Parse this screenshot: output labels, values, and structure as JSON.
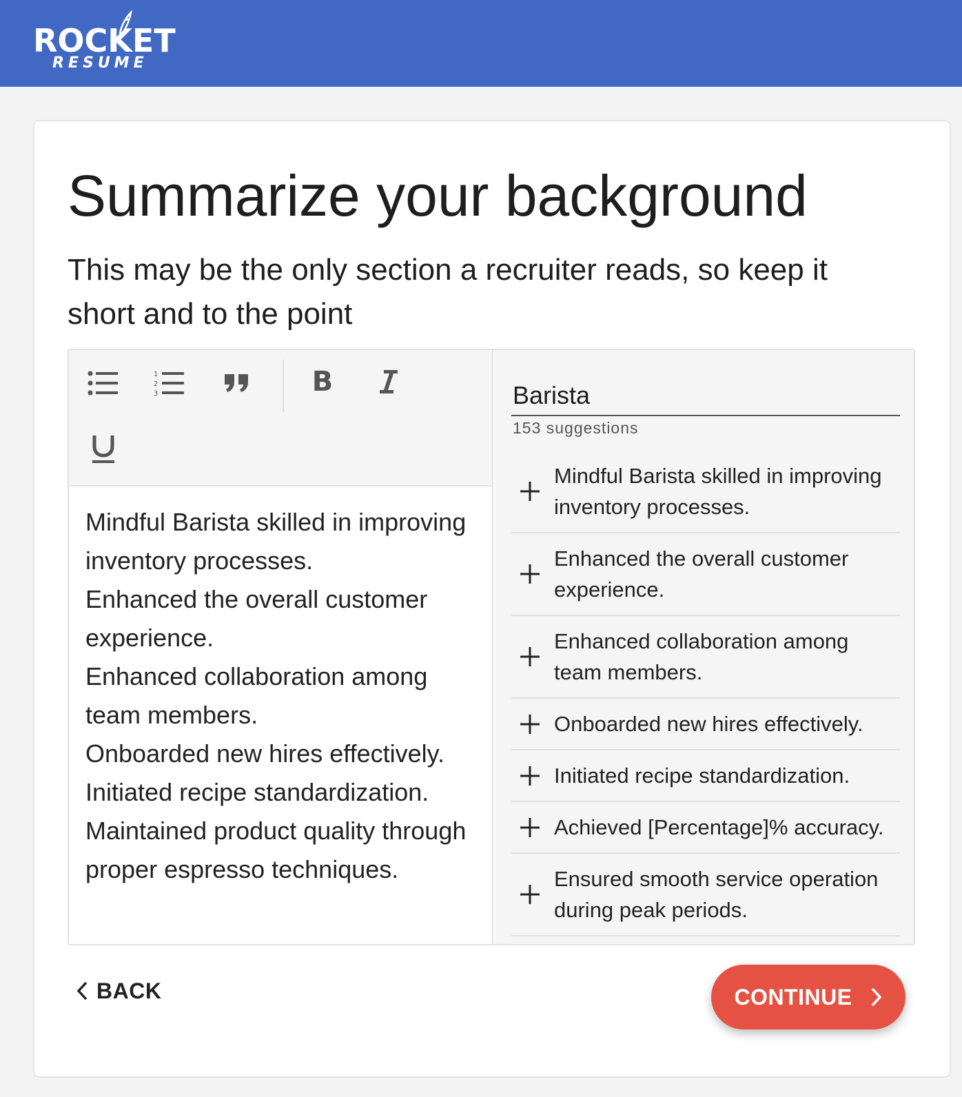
{
  "header": {
    "logo_line1": "ROCKET",
    "logo_line2": "RESUME",
    "color": "#4169c3"
  },
  "page": {
    "title": "Summarize your background",
    "subtitle": "This may be the only section a recruiter reads, so keep it short and to the point"
  },
  "toolbar": {
    "buttons": [
      {
        "name": "bulleted-list",
        "icon": "bulleted-list-icon"
      },
      {
        "name": "numbered-list",
        "icon": "numbered-list-icon"
      },
      {
        "name": "blockquote",
        "icon": "quote-icon"
      },
      {
        "name": "bold",
        "icon": "bold-icon",
        "glyph": "B"
      },
      {
        "name": "italic",
        "icon": "italic-icon",
        "glyph": "I"
      },
      {
        "name": "underline",
        "icon": "underline-icon",
        "glyph": "U"
      }
    ]
  },
  "editor": {
    "lines": [
      "Mindful Barista skilled in improving inventory processes.",
      "Enhanced the overall customer experience.",
      "Enhanced collaboration among team members.",
      "Onboarded new hires effectively.",
      "Initiated recipe standardization.",
      "Maintained product quality through proper espresso techniques."
    ]
  },
  "suggestions_panel": {
    "search_value": "Barista",
    "count_label": "153 suggestions",
    "items": [
      "Mindful Barista skilled in improving inventory processes.",
      "Enhanced the overall customer experience.",
      "Enhanced collaboration among team members.",
      "Onboarded new hires effectively.",
      "Initiated recipe standardization.",
      "Achieved [Percentage]% accuracy.",
      "Ensured smooth service operation during peak periods."
    ]
  },
  "nav": {
    "back_label": "BACK",
    "continue_label": "CONTINUE",
    "continue_color": "#e55243"
  }
}
